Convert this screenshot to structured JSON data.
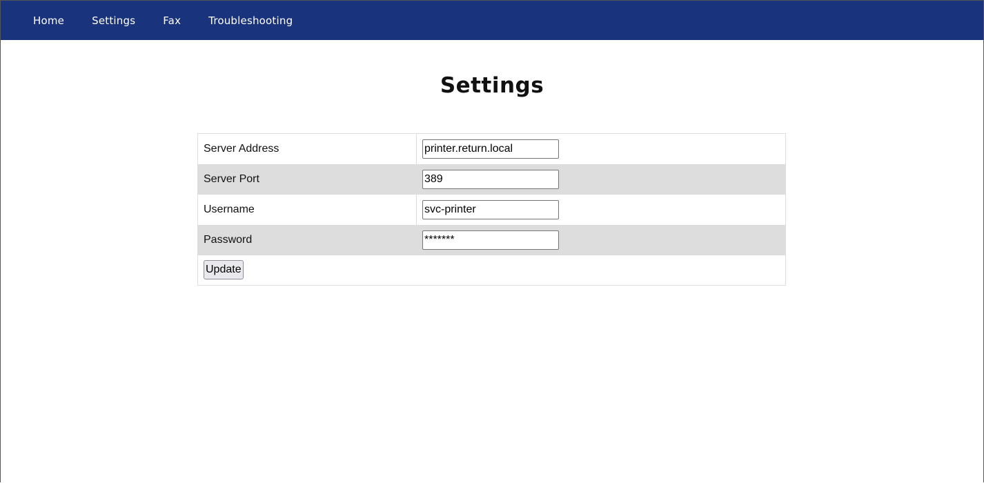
{
  "nav": {
    "items": [
      {
        "label": "Home"
      },
      {
        "label": "Settings"
      },
      {
        "label": "Fax"
      },
      {
        "label": "Troubleshooting"
      }
    ]
  },
  "page": {
    "title": "Settings"
  },
  "form": {
    "rows": [
      {
        "label": "Server Address",
        "value": "printer.return.local",
        "type": "text"
      },
      {
        "label": "Server Port",
        "value": "389",
        "type": "text"
      },
      {
        "label": "Username",
        "value": "svc-printer",
        "type": "text"
      },
      {
        "label": "Password",
        "value": "*******",
        "type": "text"
      }
    ],
    "submit_label": "Update"
  },
  "colors": {
    "navbar_bg": "#19337c",
    "row_alt_bg": "#dddddd",
    "nav_text": "#ffffff"
  }
}
